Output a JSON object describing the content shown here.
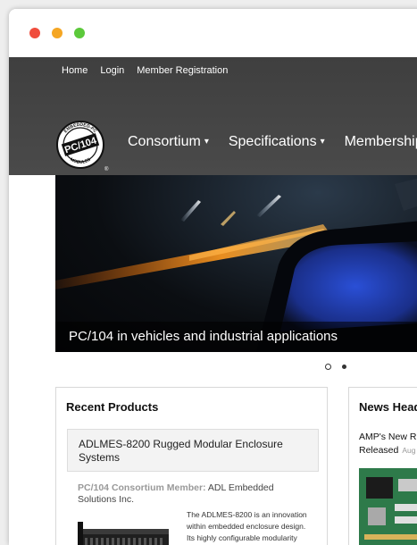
{
  "topnav": {
    "items": [
      {
        "label": "Home"
      },
      {
        "label": "Login"
      },
      {
        "label": "Member Registration"
      }
    ]
  },
  "logo": {
    "arc_top": "EMBEDDED-PC",
    "main": "PC/104",
    "arc_bottom": "MODULES",
    "registered": "®"
  },
  "mainnav": {
    "items": [
      {
        "label": "Consortium",
        "caret": "▾"
      },
      {
        "label": "Specifications",
        "caret": "▾"
      },
      {
        "label": "Membership",
        "caret": ""
      }
    ]
  },
  "hero": {
    "caption": "PC/104 in vehicles and industrial applications",
    "slide_count": 2,
    "active_slide": 1
  },
  "products": {
    "title": "Recent Products",
    "product_name": "ADLMES-8200 Rugged Modular Enclosure Systems",
    "member_label": "PC/104 Consortium Member:",
    "member_value": "ADL Embedded Solutions Inc.",
    "description": "The ADLMES-8200 is an innovation within embedded enclosure design. Its highly configurable modularity"
  },
  "news": {
    "title": "News Head",
    "headline": "AMP's New Ru",
    "headline_line2": "Released",
    "date": "Aug"
  },
  "colors": {
    "header_bg": "#444444",
    "close_dot": "#f04d3d",
    "minimize_dot": "#f5a623",
    "zoom_dot": "#5cc93b"
  }
}
